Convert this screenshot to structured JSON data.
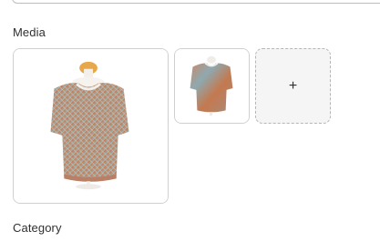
{
  "sections": {
    "media_label": "Media",
    "category_label": "Category"
  },
  "media": {
    "images": [
      {
        "name": "sweater-image-main",
        "alt": "Multicolor knit sweater on mannequin"
      },
      {
        "name": "sweater-image-secondary",
        "alt": "Multicolor knit sweater on mannequin"
      }
    ],
    "add_button": {
      "symbol": "+",
      "icon": "plus-icon"
    }
  },
  "colors": {
    "border": "#cfcfcf",
    "add_bg": "#f5f5f5",
    "text": "#303030"
  }
}
